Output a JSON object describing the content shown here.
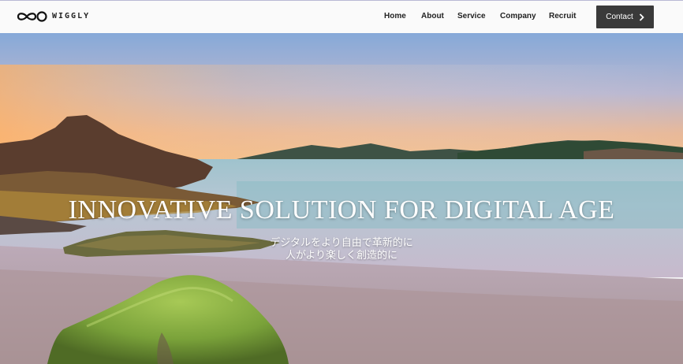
{
  "header": {
    "logo": {
      "text": "WIGGLY",
      "icon": "infinity-wave-icon"
    },
    "nav": {
      "home": "Home",
      "about": "About",
      "service": "Service",
      "company": "Company",
      "recruit": "Recruit"
    },
    "contact": {
      "label": "Contact",
      "icon": "chevron-right-icon"
    }
  },
  "hero": {
    "title": "INNOVATIVE SOLUTION FOR DIGITAL AGE",
    "subtitle_line1": "デジタルをより自由で革新的に",
    "subtitle_line2": "人がより楽しく創造的に",
    "colors": {
      "sky_top": "#7fa6d6",
      "sky_horizon": "#f5b37a",
      "sea": "#8fb8c4",
      "sand": "#b8a6b4",
      "moss": "#7ea53a"
    }
  },
  "colors": {
    "nav_bg": "#fafafa",
    "contact_bg": "#3a3a3a",
    "text_dark": "#222222"
  }
}
